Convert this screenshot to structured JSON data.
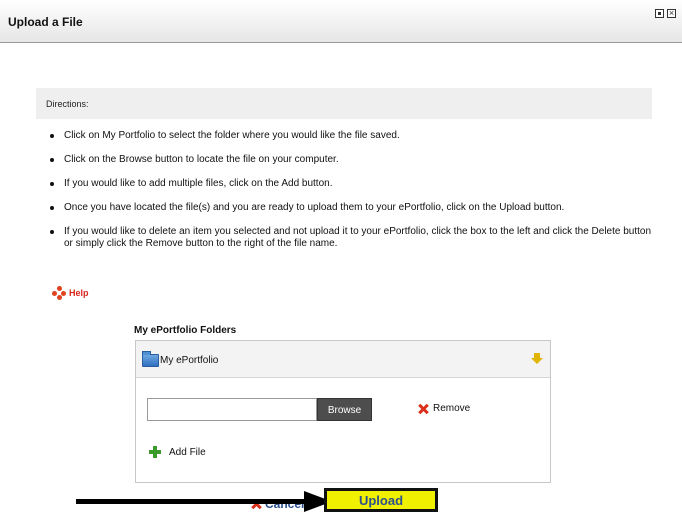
{
  "dialog": {
    "title": "Upload a File"
  },
  "directions": {
    "heading": "Directions:",
    "items": [
      "Click on My Portfolio to select the folder where you would like the file saved.",
      "Click on the Browse button to locate the file on your computer.",
      "If you would like to add multiple files, click on the Add button.",
      "Once you have located the file(s) and you are ready to upload them to your ePortfolio, click on the Upload button.",
      " If you would like to delete an item you selected and not upload it to your ePortfolio, click the box to the left and click the Delete button or simply click the Remove button to the right of the file name."
    ]
  },
  "help": {
    "label": "Help"
  },
  "folders": {
    "title": "My ePortfolio Folders",
    "selected_folder": "My ePortfolio",
    "file_input_value": "",
    "browse_label": "Browse",
    "remove_label": "Remove",
    "add_file_label": "Add File"
  },
  "actions": {
    "cancel_label": "Cancel",
    "upload_label": "Upload"
  },
  "colors": {
    "upload_bg": "#f0f000",
    "link_blue": "#2d4f8c",
    "remove_red": "#d8301a",
    "add_green": "#3a9a2a"
  }
}
